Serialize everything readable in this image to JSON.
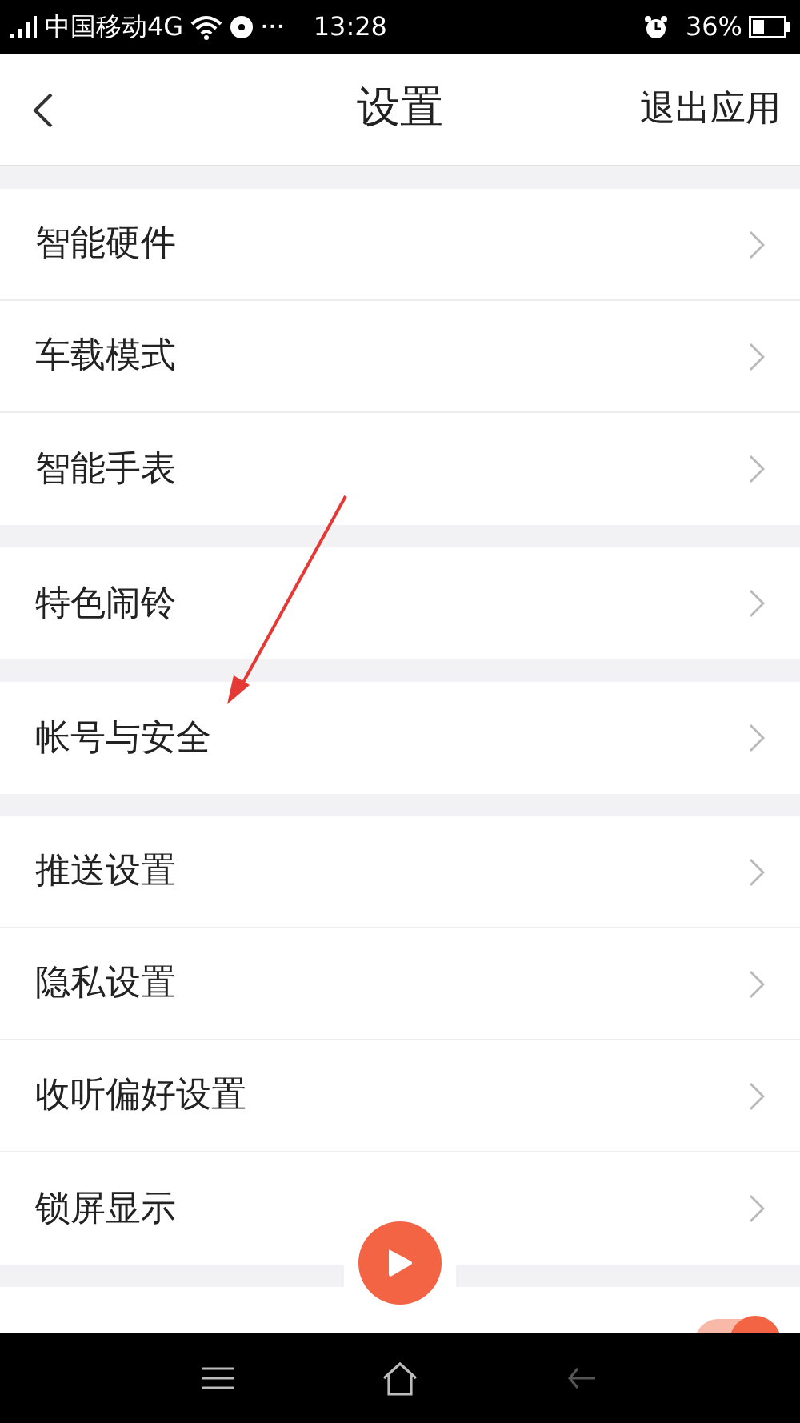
{
  "status_bar": {
    "carrier": "中国移动4G",
    "dots": "···",
    "time": "13:28",
    "battery": "36%"
  },
  "header": {
    "title": "设置",
    "action": "退出应用"
  },
  "sections": [
    {
      "items": [
        {
          "label": "智能硬件",
          "kind": "link"
        },
        {
          "label": "车载模式",
          "kind": "link"
        },
        {
          "label": "智能手表",
          "kind": "link"
        }
      ]
    },
    {
      "items": [
        {
          "label": "特色闹铃",
          "kind": "link"
        }
      ]
    },
    {
      "items": [
        {
          "label": "帐号与安全",
          "kind": "link"
        }
      ]
    },
    {
      "items": [
        {
          "label": "推送设置",
          "kind": "link"
        },
        {
          "label": "隐私设置",
          "kind": "link"
        },
        {
          "label": "收听偏好设置",
          "kind": "link"
        },
        {
          "label": "锁屏显示",
          "kind": "link"
        }
      ]
    },
    {
      "items": [
        {
          "kind": "toggle",
          "on": true
        }
      ]
    }
  ]
}
